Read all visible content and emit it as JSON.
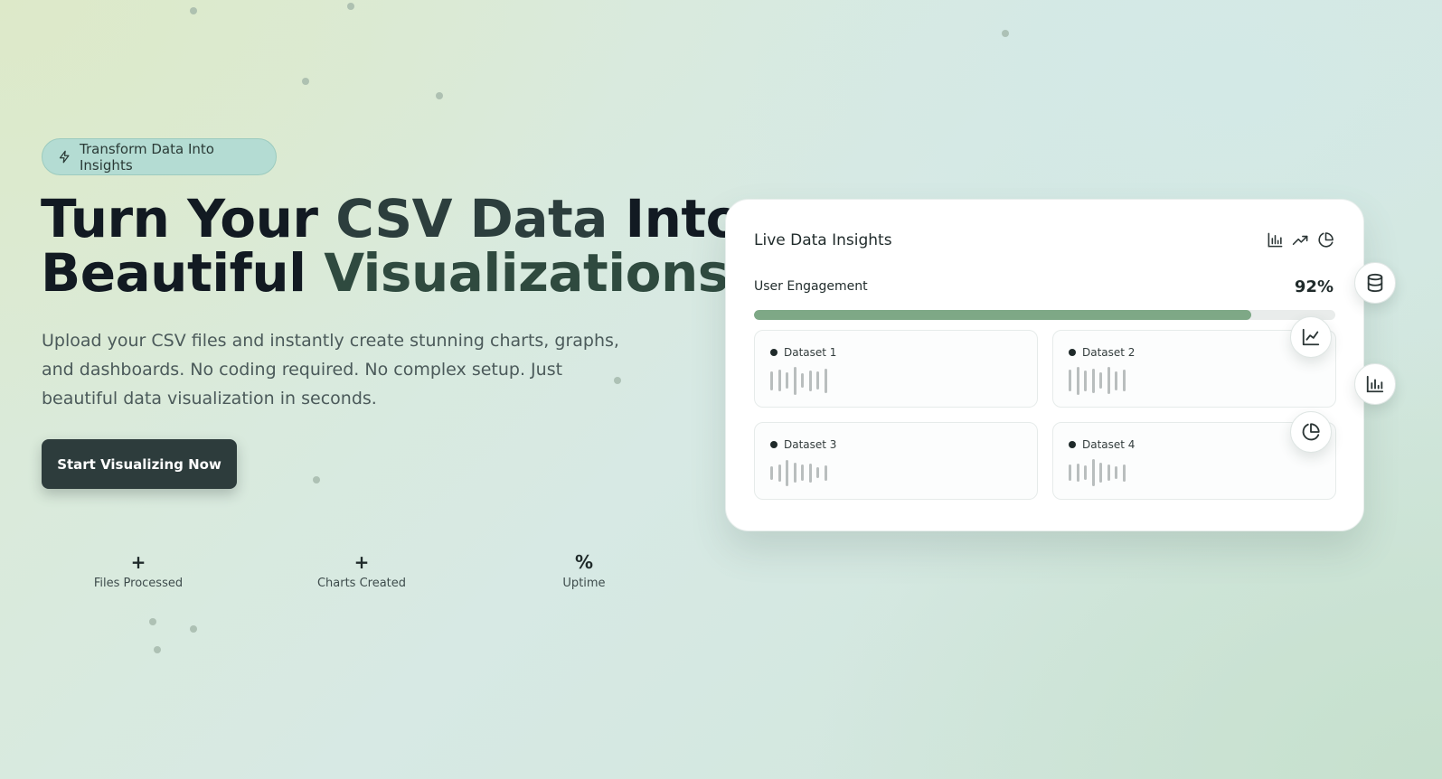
{
  "hero": {
    "badge": "Transform Data Into Insights",
    "title_line1_a": "Turn Your ",
    "title_line1_b": "CSV Data",
    "title_line1_c": " Into",
    "title_line2_a": "Beautiful ",
    "title_line2_b": "Visualizations",
    "subtitle": "Upload your CSV files and instantly create stunning charts, graphs, and dashboards. No coding required. No complex setup. Just beautiful data visualization in seconds.",
    "cta": "Start Visualizing Now"
  },
  "stats": [
    {
      "value": "+",
      "label": "Files Processed"
    },
    {
      "value": "+",
      "label": "Charts Created"
    },
    {
      "value": "%",
      "label": "Uptime"
    }
  ],
  "card": {
    "title": "Live Data Insights",
    "icons": [
      "bar-chart-icon",
      "trending-up-icon",
      "pie-chart-icon"
    ],
    "metric_label": "User Engagement",
    "metric_value": "92%",
    "progress_fraction": 0.855,
    "datasets": [
      {
        "label": "Dataset 1",
        "bars": [
          0.62,
          0.72,
          0.52,
          0.9,
          0.48,
          0.68,
          0.58,
          0.78
        ]
      },
      {
        "label": "Dataset 2",
        "bars": [
          0.72,
          0.9,
          0.68,
          0.78,
          0.52,
          0.88,
          0.62,
          0.72
        ]
      },
      {
        "label": "Dataset 3",
        "bars": [
          0.44,
          0.56,
          0.86,
          0.66,
          0.52,
          0.62,
          0.36,
          0.5
        ]
      },
      {
        "label": "Dataset 4",
        "bars": [
          0.52,
          0.58,
          0.46,
          0.88,
          0.66,
          0.54,
          0.4,
          0.56
        ]
      }
    ]
  },
  "floating_icons": [
    "database-icon",
    "line-chart-icon",
    "bar-chart-icon",
    "pie-chart-icon"
  ],
  "colors": {
    "accent": "#7ea886",
    "cta_bg": "#2d3c3c",
    "badge_bg": "#b4dcd3"
  }
}
